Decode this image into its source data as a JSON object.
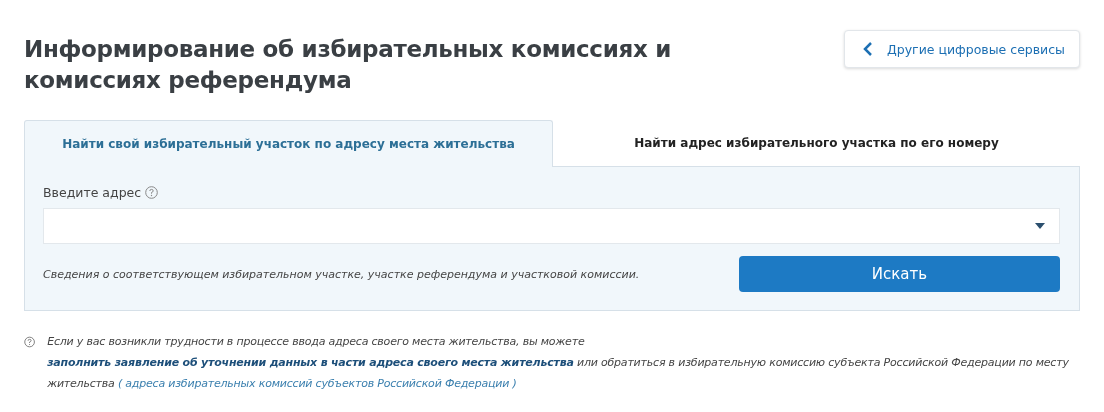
{
  "page_title": "Информирование об избирательных комиссиях и комиссиях референдума",
  "back_button": {
    "label": "Другие цифровые сервисы"
  },
  "tabs": [
    {
      "label": "Найти свой избирательный участок по адресу места жительства",
      "selected": true
    },
    {
      "label": "Найти адрес избирательного участка по его номеру",
      "selected": false
    }
  ],
  "address_field": {
    "label": "Введите адрес"
  },
  "hint": "Сведения о соответствующем избирательном участке, участке референдума и участковой комиссии.",
  "search_button": {
    "label": "Искать"
  },
  "note": {
    "text_before": "Если у вас возникли трудности в процессе ввода адреса своего места жительства, вы можете ",
    "link_1": "заполнить заявление об уточнении данных в части адреса своего места жительства",
    "text_middle": " или обратиться в избирательную комиссию субъекта Российской Федерации по месту жительства ",
    "link_2": "( адреса избирательных комиссий субъектов Российской Федерации )"
  }
}
